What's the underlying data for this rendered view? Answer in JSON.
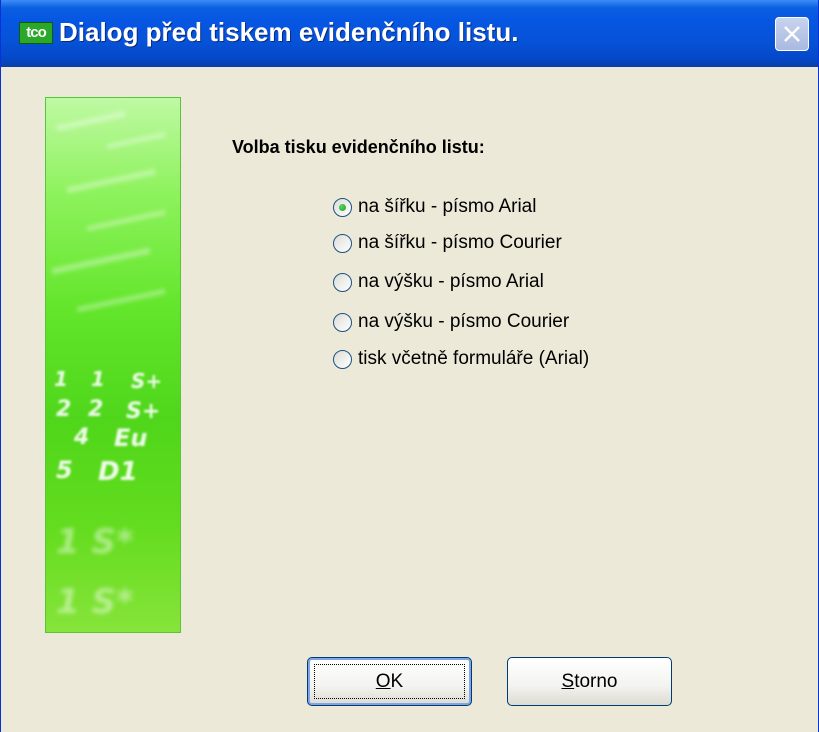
{
  "window": {
    "title": "Dialog před tiskem evidenčního listu.",
    "icon_text": "tco",
    "icon": "app-logo-icon",
    "close_icon": "close-icon"
  },
  "side_image": {
    "description_icon": "decorative-image",
    "colors": [
      "#bff9a4",
      "#62e52a",
      "#86e43a"
    ]
  },
  "form": {
    "heading": "Volba tisku evidenčního listu:",
    "options": [
      {
        "label": "na šířku - písmo Arial",
        "selected": true
      },
      {
        "label": "na šířku - písmo Courier",
        "selected": false
      },
      {
        "label": "na výšku - písmo Arial",
        "selected": false
      },
      {
        "label": "na výšku - písmo Courier",
        "selected": false
      },
      {
        "label": "tisk včetně formuláře (Arial)",
        "selected": false
      }
    ]
  },
  "buttons": {
    "ok_mnemonic": "O",
    "ok_rest": "K",
    "storno_mnemonic": "S",
    "storno_rest": "torno"
  },
  "colors": {
    "titlebar": "#0653d9",
    "dialog_bg": "#ece9d8",
    "radio_dot": "#21a121"
  }
}
